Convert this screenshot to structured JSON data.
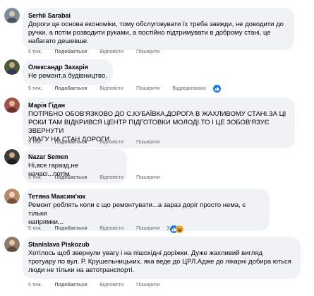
{
  "comments": [
    {
      "author": "Serhii Sarabai",
      "text": "Дороги це основа економіки, тому обслуговувати їх треба завжди, не доводити до\nручки, а потім розводити руками, а постійно підтримувати в доброму стані, це\nнабагато дешевше.",
      "time": "5 тиж.",
      "like_label": "Подобається",
      "reply_label": "Відповісти",
      "share_label": "Поширити",
      "avatar_color": "#7a8b99"
    },
    {
      "author": "Олександр Захарія",
      "text": "Не ремонт,а будівництво.",
      "time": "5 тиж.",
      "like_label": "Подобається",
      "reply_label": "Відповісти",
      "share_label": "Поширити",
      "edited_label": "Відредаговано",
      "reaction_icon": "like-icon",
      "avatar_color": "#4a5a3a"
    },
    {
      "author": "Марія Гідан",
      "text": "ПОТРІБНО ОБОВ'ЯЗКОВО ДО С.КУБАЇВКА.ДОРОГА В ЖАХЛИВОМУ СТАНІ.ЗА ЦІ\nРОКИ ТАМ ВІДКРИВСЯ ЦЕНТР ПІДГОТОВКИ МОЛОДІ.ТО І ЦЕ ЗОБОВ'ЯЗУЄ ЗВЕРНУТИ\nУВАГУ НА СТАН ДОРОГИ",
      "time": "5 тиж.",
      "like_label": "Подобається",
      "reply_label": "Відповісти",
      "share_label": "Поширити",
      "avatar_color": "#a0524a"
    },
    {
      "author": "Nazar Semen",
      "text": "Ні,все гаразд,не начасі...потім",
      "time": "5 тиж.",
      "like_label": "Подобається",
      "reply_label": "Відповісти",
      "share_label": "Поширити",
      "avatar_color": "#3b3b3b"
    },
    {
      "author": "Тетяна Максим'юк",
      "text": "Ремонт роблять коли є що ремонтувати...а зараз доріг просто нема, є тільки\nнапрямки...",
      "time": "5 тиж.",
      "like_label": "Подобається",
      "reply_label": "Відповісти",
      "share_label": "Поширити",
      "reaction_count": "3",
      "reaction_icons": [
        "like-icon",
        "haha-icon"
      ],
      "avatar_color": "#b58a6a"
    },
    {
      "author": "Stanislava Piskozub",
      "text": "Хотілось щоб звернули увагу і на пішохідні доріжки. Дуже жахливий вигляд\nтротуару по вул. Р. Крушельницьких, яка веде до ЦРЛ.Адже до лікарні добира ються\nлюди не тільки на автотранспорті.",
      "time": "5 тиж.",
      "like_label": "Подобається",
      "reply_label": "Відповісти",
      "share_label": "Поширити",
      "avatar_color": "#8a7a6a"
    }
  ],
  "colors": {
    "bubble": "#f0f2f5",
    "meta": "#65676b",
    "like_blue": "#1877f2",
    "haha_yellow": "#f7b125"
  }
}
